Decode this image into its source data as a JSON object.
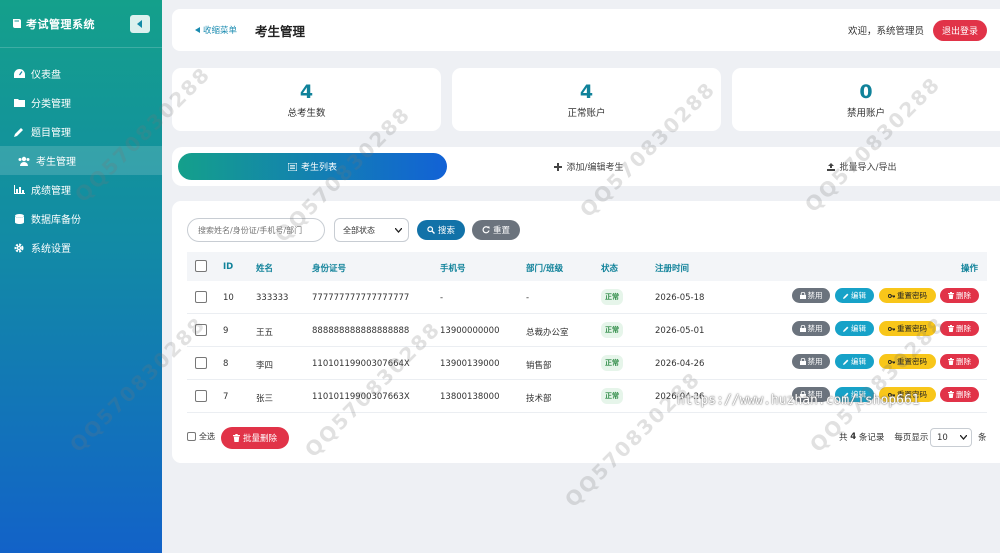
{
  "sidebar": {
    "title": "考试管理系统",
    "items": [
      {
        "label": "仪表盘",
        "icon": "dashboard-icon"
      },
      {
        "label": "分类管理",
        "icon": "folder-icon"
      },
      {
        "label": "题目管理",
        "icon": "pencil-icon"
      },
      {
        "label": "考生管理",
        "icon": "users-icon"
      },
      {
        "label": "成绩管理",
        "icon": "bar-chart-icon"
      },
      {
        "label": "数据库备份",
        "icon": "database-icon"
      },
      {
        "label": "系统设置",
        "icon": "gear-icon"
      }
    ]
  },
  "header": {
    "collapse_label": "收缩菜单",
    "page_title": "考生管理",
    "welcome": "欢迎，系统管理员",
    "logout_label": "退出登录"
  },
  "stats": [
    {
      "value": "4",
      "label": "总考生数"
    },
    {
      "value": "4",
      "label": "正常账户"
    },
    {
      "value": "0",
      "label": "禁用账户"
    }
  ],
  "tabs": [
    {
      "label": "考生列表",
      "icon": "list-icon",
      "active": true
    },
    {
      "label": "添加/编辑考生",
      "icon": "plus-icon",
      "active": false
    },
    {
      "label": "批量导入/导出",
      "icon": "upload-icon",
      "active": false
    }
  ],
  "filters": {
    "search_placeholder": "搜索姓名/身份证/手机号/部门",
    "status_value": "全部状态",
    "search_label": "搜索",
    "reset_label": "重置"
  },
  "table": {
    "headers": {
      "id": "ID",
      "name": "姓名",
      "idcard": "身份证号",
      "phone": "手机号",
      "dept": "部门/班级",
      "status": "状态",
      "time": "注册时间",
      "ops": "操作"
    },
    "rows": [
      {
        "id": "10",
        "name": "333333",
        "idcard": "777777777777777777",
        "phone": "-",
        "dept": "-",
        "status": "正常",
        "time": "2026-05-18"
      },
      {
        "id": "9",
        "name": "王五",
        "idcard": "888888888888888888",
        "phone": "13900000000",
        "dept": "总裁办公室",
        "status": "正常",
        "time": "2026-05-01"
      },
      {
        "id": "8",
        "name": "李四",
        "idcard": "11010119900307664X",
        "phone": "13900139000",
        "dept": "销售部",
        "status": "正常",
        "time": "2026-04-26"
      },
      {
        "id": "7",
        "name": "张三",
        "idcard": "11010119900307663X",
        "phone": "13800138000",
        "dept": "技术部",
        "status": "正常",
        "time": "2026-04-26"
      }
    ],
    "actions": {
      "disable": "禁用",
      "edit": "编辑",
      "reset_pwd": "重置密码",
      "delete": "删除"
    }
  },
  "footer": {
    "select_all": "全选",
    "batch_delete": "批量删除",
    "total_prefix": "共",
    "total_count": "4",
    "total_suffix": "条记录",
    "per_page_label": "每页显示",
    "page_size": "10",
    "unit": "条"
  },
  "overlay": {
    "watermark": "QQ570830288",
    "url": "https://www.huzhan.com/ishop661"
  },
  "colors": {
    "accent": "#10829a",
    "danger": "#e13348",
    "warning": "#f8c61a",
    "info": "#17a2c8"
  }
}
